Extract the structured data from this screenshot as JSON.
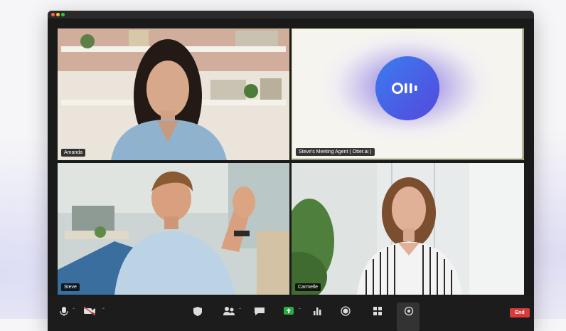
{
  "participants": [
    {
      "name": "Amanda"
    },
    {
      "name": "Steve's Meeting Agent ( Otter.ai )"
    },
    {
      "name": "Steve"
    },
    {
      "name": "Carmelle"
    }
  ],
  "toolbar": {
    "end_label": "End"
  },
  "colors": {
    "end": "#d93a3a",
    "otter_blue": "#4a5ce0",
    "active_border": "#d5d78a",
    "share_green": "#27ae3f"
  }
}
